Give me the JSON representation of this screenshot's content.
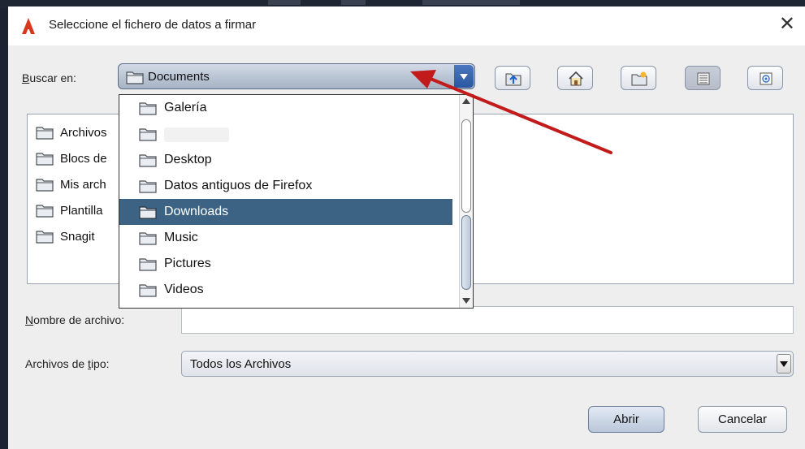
{
  "dialog": {
    "title": "Seleccione el fichero de datos a firmar",
    "close_glyph": "✕"
  },
  "look_in": {
    "label_underlined": "B",
    "label_rest": "uscar en:",
    "selected": "Documents"
  },
  "toolbar_buttons": [
    {
      "name": "up-one-level-button",
      "icon": "folder-up-icon"
    },
    {
      "name": "home-button",
      "icon": "home-icon"
    },
    {
      "name": "new-folder-button",
      "icon": "new-folder-icon"
    },
    {
      "name": "list-view-button",
      "icon": "list-view-icon",
      "pressed": true
    },
    {
      "name": "details-view-button",
      "icon": "details-view-icon"
    }
  ],
  "file_list": [
    "Archivos",
    "Blocs de",
    "Mis arch",
    "Plantilla",
    "Snagit"
  ],
  "dropdown_items": [
    {
      "label": "Galería",
      "selected": false
    },
    {
      "label": "",
      "selected": false,
      "blurred": true
    },
    {
      "label": "Desktop",
      "selected": false
    },
    {
      "label": "Datos antiguos de Firefox",
      "selected": false
    },
    {
      "label": "Downloads",
      "selected": true
    },
    {
      "label": "Music",
      "selected": false
    },
    {
      "label": "Pictures",
      "selected": false
    },
    {
      "label": "Videos",
      "selected": false
    }
  ],
  "filename": {
    "label_underlined": "N",
    "label_rest": "ombre de archivo:",
    "value": ""
  },
  "filetype": {
    "label_pre": "Archivos de ",
    "label_underlined": "t",
    "label_rest": "ipo:",
    "selected": "Todos los Archivos"
  },
  "buttons": {
    "open": "Abrir",
    "cancel": "Cancelar"
  },
  "colors": {
    "selection": "#3c6384",
    "annotation_arrow": "#c21b1b"
  }
}
